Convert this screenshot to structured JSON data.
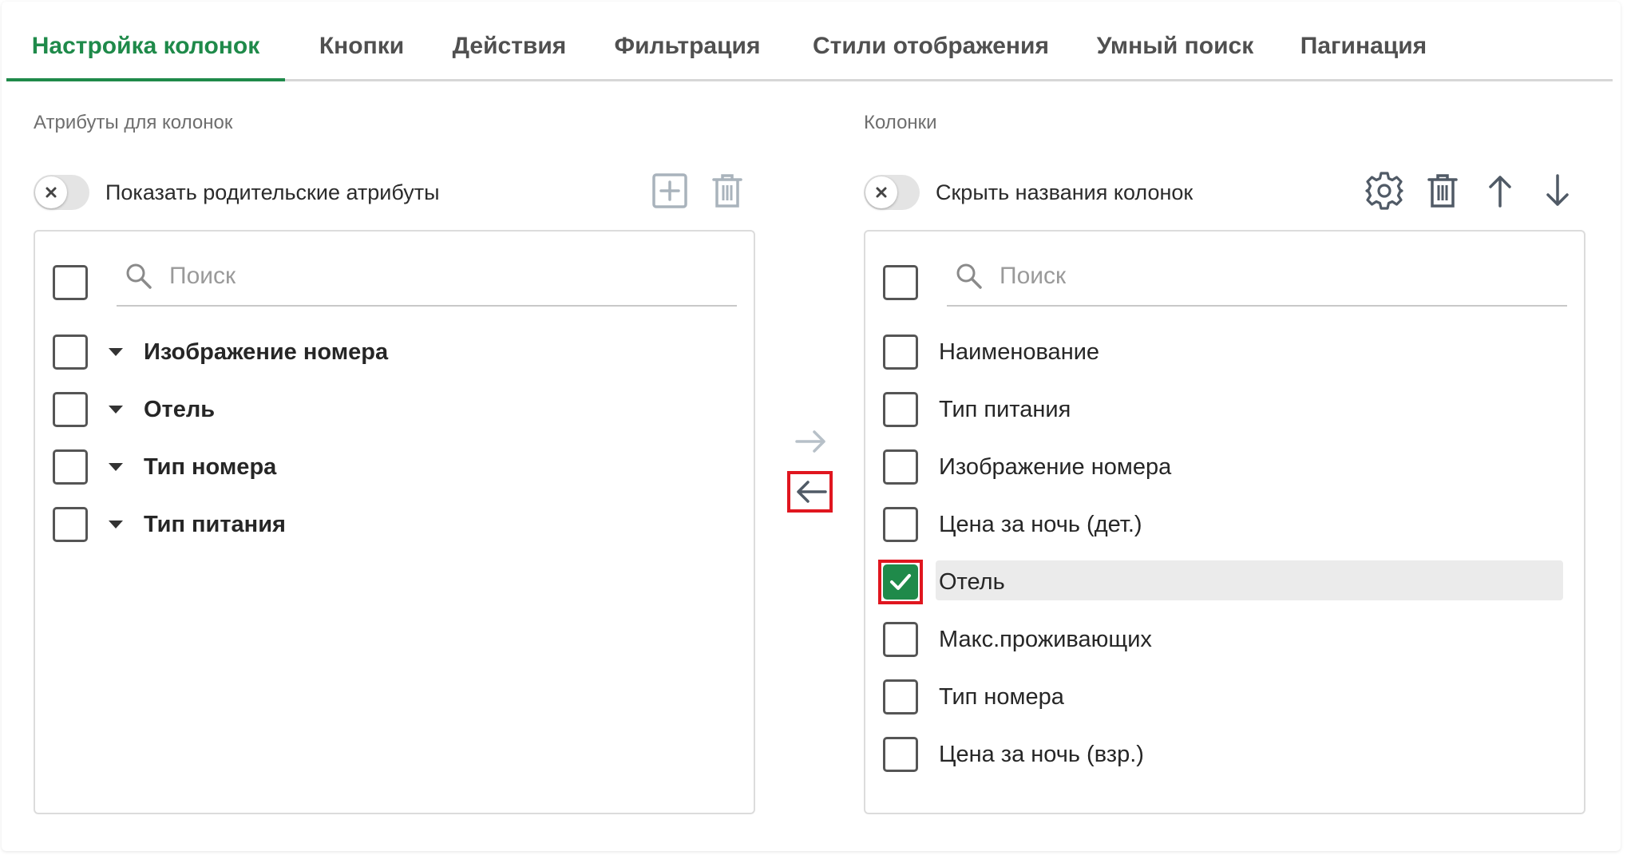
{
  "tabs": [
    {
      "label": "Настройка колонок",
      "active": true
    },
    {
      "label": "Кнопки",
      "active": false
    },
    {
      "label": "Действия",
      "active": false
    },
    {
      "label": "Фильтрация",
      "active": false
    },
    {
      "label": "Стили отображения",
      "active": false
    },
    {
      "label": "Умный поиск",
      "active": false
    },
    {
      "label": "Пагинация",
      "active": false
    }
  ],
  "left": {
    "section_label": "Атрибуты для колонок",
    "toggle_label": "Показать родительские атрибуты",
    "toggle_on": false,
    "toolbar_icons": [
      "add-box-icon",
      "trash-icon"
    ],
    "search_placeholder": "Поиск",
    "items": [
      {
        "label": "Изображение номера",
        "checked": false,
        "expandable": true
      },
      {
        "label": "Отель",
        "checked": false,
        "expandable": true
      },
      {
        "label": "Тип номера",
        "checked": false,
        "expandable": true
      },
      {
        "label": "Тип питания",
        "checked": false,
        "expandable": true
      }
    ]
  },
  "transfer": {
    "move_right_icon": "arrow-right-icon",
    "move_left_icon": "arrow-left-icon"
  },
  "right": {
    "section_label": "Колонки",
    "toggle_label": "Скрыть названия колонок",
    "toggle_on": false,
    "toolbar_icons": [
      "gear-icon",
      "trash-icon",
      "arrow-up-icon",
      "arrow-down-icon"
    ],
    "search_placeholder": "Поиск",
    "items": [
      {
        "label": "Наименование",
        "checked": false
      },
      {
        "label": "Тип питания",
        "checked": false
      },
      {
        "label": "Изображение номера",
        "checked": false
      },
      {
        "label": "Цена за ночь (дет.)",
        "checked": false
      },
      {
        "label": "Отель",
        "checked": true
      },
      {
        "label": "Макс.проживающих",
        "checked": false
      },
      {
        "label": "Тип номера",
        "checked": false
      },
      {
        "label": "Цена за ночь (взр.)",
        "checked": false
      }
    ]
  },
  "colors": {
    "accent": "#1f8a4a",
    "highlight_frame": "#e0161f",
    "muted_icon": "#a9b3bc",
    "dark_icon": "#505a66"
  }
}
